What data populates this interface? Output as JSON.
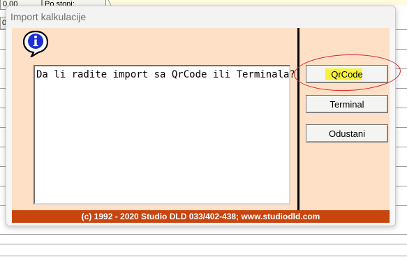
{
  "background_app": {
    "cell_value": "0,00",
    "cell_label": "Po stopi:",
    "left_cell": "0"
  },
  "dialog": {
    "title": "Import kalkulacije",
    "message": "Da li radite import sa QrCode ili Terminala?",
    "buttons": {
      "qrcode": "QrCode",
      "terminal": "Terminal",
      "cancel": "Odustani"
    },
    "footer": "(c) 1992 - 2020 Studio DLD 033/402-438; www.studiodld.com",
    "icon": "info-icon"
  },
  "colors": {
    "client_bg": "#fde0c5",
    "footer_bg": "#c8450f",
    "highlight": "#f7f23a",
    "annotation_circle": "#d9202a"
  }
}
